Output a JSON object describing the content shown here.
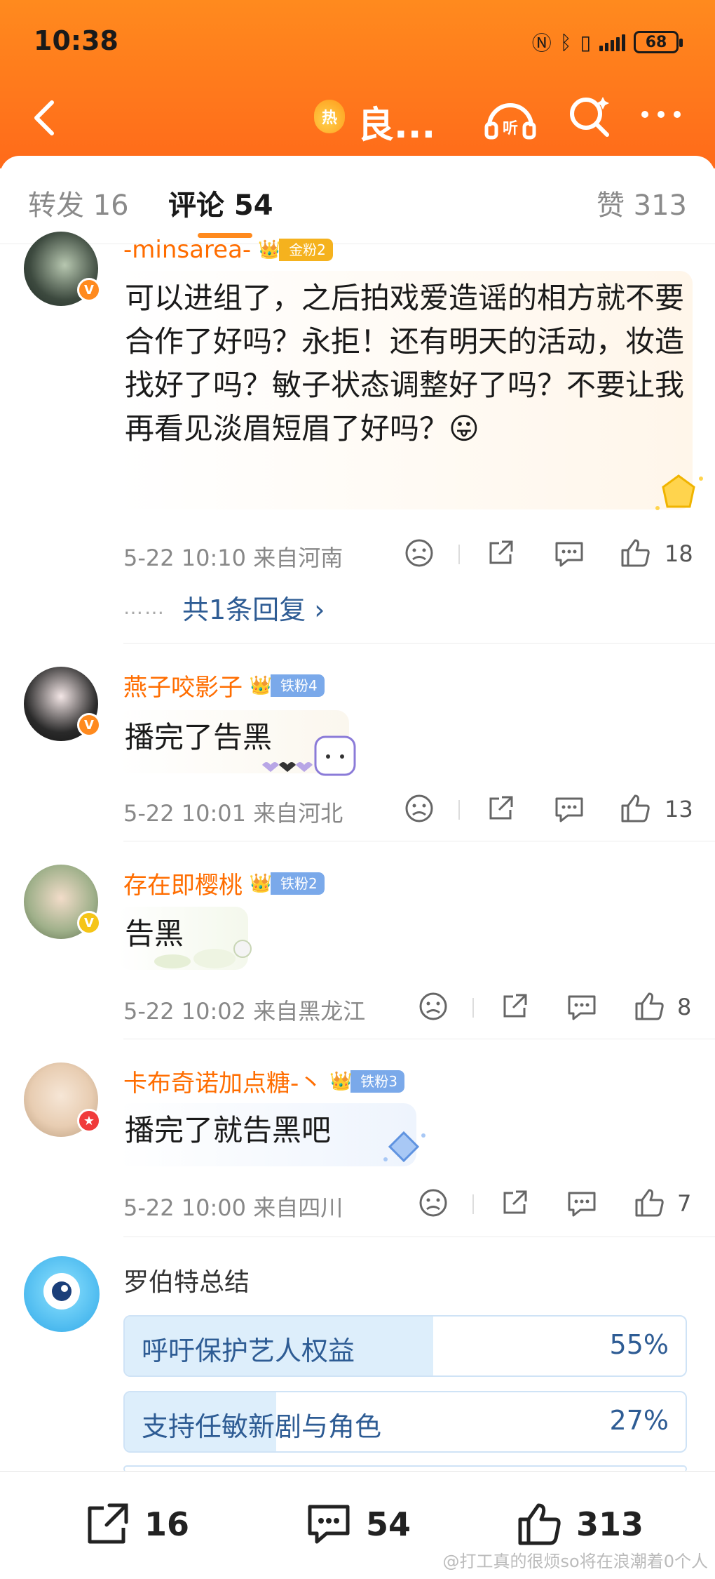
{
  "status_bar": {
    "time": "10:38",
    "battery": "68"
  },
  "nav": {
    "title": "良...",
    "hot_badge": "热"
  },
  "tabs": {
    "repost": "转发 16",
    "comment": "评论 54",
    "like": "赞 313"
  },
  "comments": [
    {
      "username": "-minsarea-",
      "badge": "金粉2",
      "badge_color": "#f5b21e",
      "verify_color": "#ff8a1e",
      "text": "可以进组了，之后拍戏爱造谣的相方就不要合作了好吗？永拒！还有明天的活动，妆造找好了吗？敏子状态调整好了吗？不要让我再看见淡眉短眉了好吗？😛",
      "meta": "5-22 10:10 来自河南",
      "likes": "18",
      "reply": "共1条回复 ›",
      "reply_dots": "……"
    },
    {
      "username": "燕子咬影子",
      "badge": "铁粉4",
      "badge_color": "#7aa9ea",
      "verify_color": "#ff8a1e",
      "text": "播完了告黑",
      "meta": "5-22 10:01 来自河北",
      "likes": "13"
    },
    {
      "username": "存在即樱桃",
      "badge": "铁粉2",
      "badge_color": "#7aa9ea",
      "verify_color": "#f5c518",
      "text": "告黑",
      "meta": "5-22 10:02 来自黑龙江",
      "likes": "8"
    },
    {
      "username": "卡布奇诺加点糖-丶",
      "badge": "铁粉3",
      "badge_color": "#7aa9ea",
      "verify_color": "#f03b3b",
      "text": "播完了就告黑吧",
      "meta": "5-22 10:00 来自四川",
      "likes": "7"
    }
  ],
  "poll": {
    "author": "罗伯特总结",
    "options": [
      {
        "label": "呼吁保护艺人权益",
        "pct": "55%",
        "value": 0.55
      },
      {
        "label": "支持任敏新剧与角色",
        "pct": "27%",
        "value": 0.27
      }
    ]
  },
  "bottom_bar": {
    "repost_count": "16",
    "comment_count": "54",
    "like_count": "313",
    "watermark": "@打工真的很烦so将在浪潮着0个人"
  }
}
